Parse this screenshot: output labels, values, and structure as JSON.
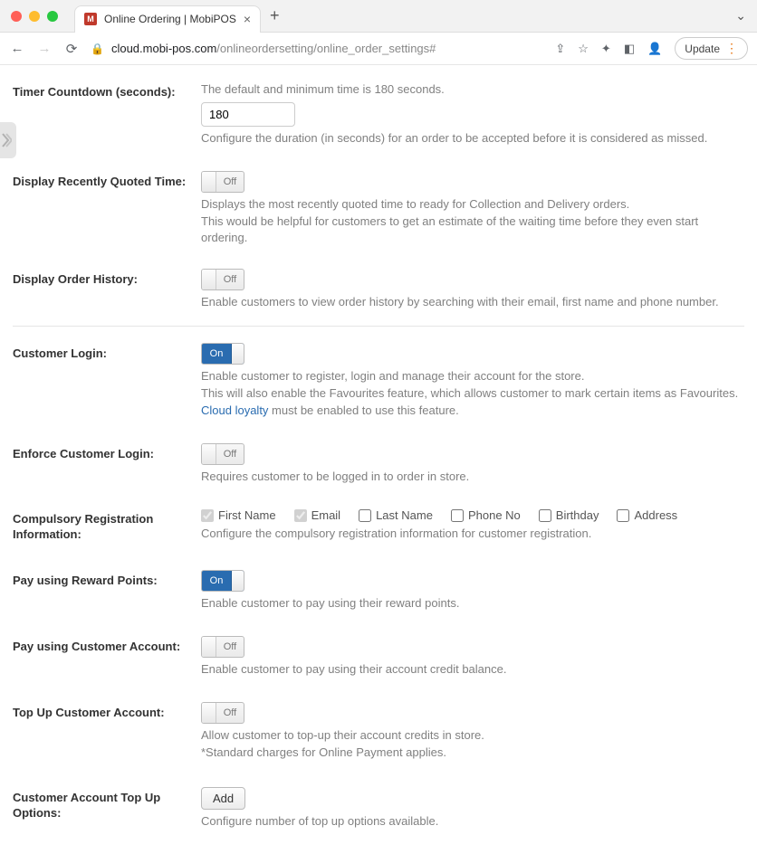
{
  "browser": {
    "tab_title": "Online Ordering | MobiPOS",
    "url_host": "cloud.mobi-pos.com",
    "url_path": "/onlineordersetting/online_order_settings#",
    "update_label": "Update"
  },
  "settings": {
    "timer": {
      "label": "Timer Countdown (seconds):",
      "hint_above": "The default and minimum time is 180 seconds.",
      "value": "180",
      "hint_below": "Configure the duration (in seconds) for an order to be accepted before it is considered as missed."
    },
    "recent_quote": {
      "label": "Display Recently Quoted Time:",
      "state": "Off",
      "hint1": "Displays the most recently quoted time to ready for Collection and Delivery orders.",
      "hint2": "This would be helpful for customers to get an estimate of the waiting time before they even start ordering."
    },
    "order_history": {
      "label": "Display Order History:",
      "state": "Off",
      "hint": "Enable customers to view order history by searching with their email, first name and phone number."
    },
    "customer_login": {
      "label": "Customer Login:",
      "state": "On",
      "hint1": "Enable customer to register, login and manage their account for the store.",
      "hint2": "This will also enable the Favourites feature, which allows customer to mark certain items as Favourites.",
      "link_text": "Cloud loyalty",
      "hint3_tail": " must be enabled to use this feature."
    },
    "enforce_login": {
      "label": "Enforce Customer Login:",
      "state": "Off",
      "hint": "Requires customer to be logged in to order in store."
    },
    "compulsory_reg": {
      "label": "Compulsory Registration Information:",
      "options": {
        "first_name": "First Name",
        "email": "Email",
        "last_name": "Last Name",
        "phone_no": "Phone No",
        "birthday": "Birthday",
        "address": "Address"
      },
      "hint": "Configure the compulsory registration information for customer registration."
    },
    "reward_points": {
      "label": "Pay using Reward Points:",
      "state": "On",
      "hint": "Enable customer to pay using their reward points."
    },
    "customer_account": {
      "label": "Pay using Customer Account:",
      "state": "Off",
      "hint": "Enable customer to pay using their account credit balance."
    },
    "topup": {
      "label": "Top Up Customer Account:",
      "state": "Off",
      "hint1": "Allow customer to top-up their account credits in store.",
      "hint2": "*Standard charges for Online Payment applies."
    },
    "topup_options": {
      "label": "Customer Account Top Up Options:",
      "button": "Add",
      "hint": "Configure number of top up options available."
    }
  }
}
